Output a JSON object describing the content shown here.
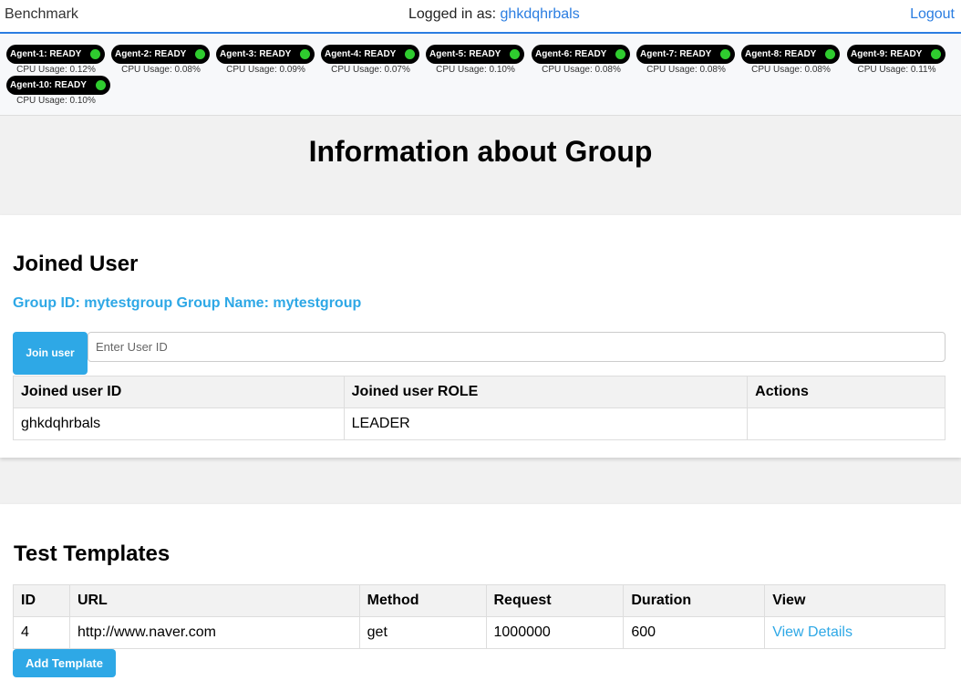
{
  "header": {
    "brand": "Benchmark",
    "logged_in_label": "Logged in as:",
    "username": "ghkdqhrbals",
    "logout_label": "Logout"
  },
  "agents": [
    {
      "label": "Agent-1: READY",
      "cpu": "CPU Usage: 0.12%"
    },
    {
      "label": "Agent-2: READY",
      "cpu": "CPU Usage: 0.08%"
    },
    {
      "label": "Agent-3: READY",
      "cpu": "CPU Usage: 0.09%"
    },
    {
      "label": "Agent-4: READY",
      "cpu": "CPU Usage: 0.07%"
    },
    {
      "label": "Agent-5: READY",
      "cpu": "CPU Usage: 0.10%"
    },
    {
      "label": "Agent-6: READY",
      "cpu": "CPU Usage: 0.08%"
    },
    {
      "label": "Agent-7: READY",
      "cpu": "CPU Usage: 0.08%"
    },
    {
      "label": "Agent-8: READY",
      "cpu": "CPU Usage: 0.08%"
    },
    {
      "label": "Agent-9: READY",
      "cpu": "CPU Usage: 0.11%"
    },
    {
      "label": "Agent-10: READY",
      "cpu": "CPU Usage: 0.10%"
    }
  ],
  "status_color": "#2fcc2f",
  "page_title": "Information about Group",
  "joined_user": {
    "heading": "Joined User",
    "group_info": "Group ID: mytestgroup Group Name: mytestgroup",
    "join_button": "Join user",
    "input_placeholder": "Enter User ID",
    "columns": [
      "Joined user ID",
      "Joined user ROLE",
      "Actions"
    ],
    "rows": [
      [
        "ghkdqhrbals",
        "LEADER",
        ""
      ]
    ]
  },
  "templates": {
    "heading": "Test Templates",
    "columns": [
      "ID",
      "URL",
      "Method",
      "Request",
      "Duration",
      "View"
    ],
    "rows": [
      [
        "4",
        "http://www.naver.com",
        "get",
        "1000000",
        "600",
        "View Details"
      ]
    ],
    "add_button": "Add Template"
  }
}
